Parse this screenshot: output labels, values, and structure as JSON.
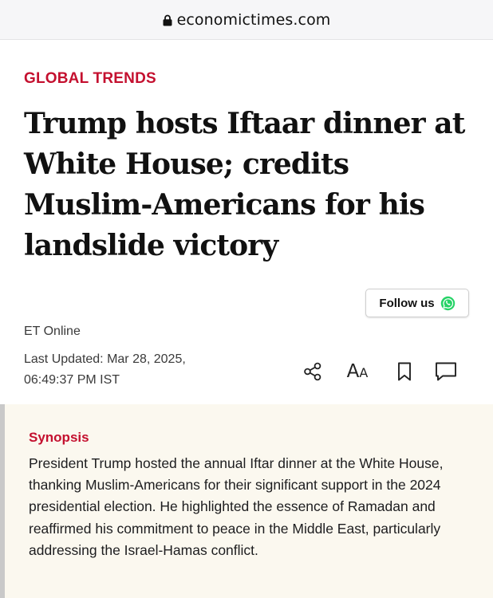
{
  "browser": {
    "url": "economictimes.com",
    "lock_icon": "lock-icon"
  },
  "article": {
    "category": "GLOBAL TRENDS",
    "headline": "Trump hosts Iftaar dinner at White House; credits Muslim-Americans for his landslide victory",
    "follow_label": "Follow us",
    "follow_icon": "whatsapp-icon",
    "author": "ET Online",
    "last_updated": "Last Updated: Mar 28, 2025, 06:49:37 PM IST",
    "tools": {
      "share_icon": "share-icon",
      "font_size_icon": "font-size-icon",
      "font_size_big": "A",
      "font_size_small": "A",
      "bookmark_icon": "bookmark-icon",
      "comment_icon": "comment-icon"
    }
  },
  "synopsis": {
    "title": "Synopsis",
    "body": "President Trump hosted the annual Iftar dinner at the White House, thanking Muslim-Americans for their significant support in the 2024 presidential election. He highlighted the essence of Ramadan and reaffirmed his commitment to peace in the Middle East, particularly addressing the Israel-Hamas conflict."
  },
  "colors": {
    "accent": "#c4102f",
    "synopsis_bg": "#fbf8ef",
    "whatsapp": "#25d366"
  }
}
